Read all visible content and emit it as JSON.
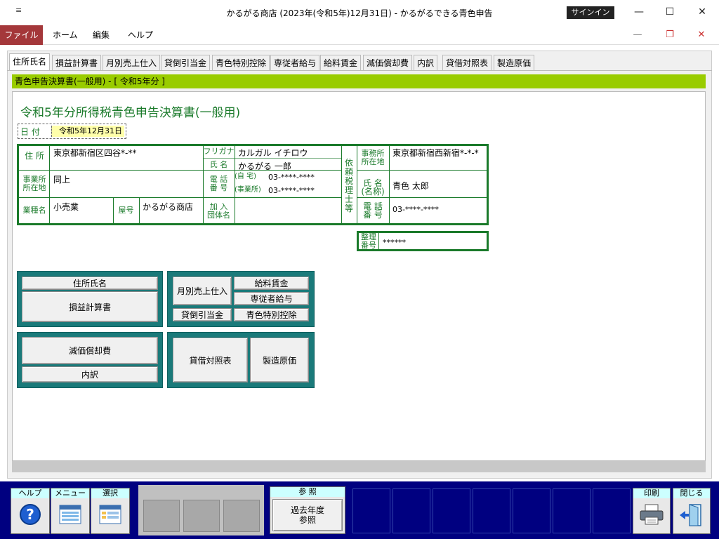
{
  "window": {
    "qat_icon": "quick-access-dropdown",
    "title": "かるがる商店 (2023年(令和5年)12月31日)  -  かるがるできる青色申告",
    "signin": "サインイン",
    "minimize": "—",
    "maximize": "☐",
    "close": "✕"
  },
  "ribbon": {
    "tabs": [
      "ファイル",
      "ホーム",
      "編集",
      "ヘルプ"
    ],
    "doc_minimize": "—",
    "doc_restore": "❐",
    "doc_close": "✕"
  },
  "form_tabs": [
    "住所氏名",
    "損益計算書",
    "月別売上仕入",
    "貸倒引当金",
    "青色特別控除",
    "専従者給与",
    "給料賃金",
    "減価償却費",
    "内訳",
    "貸借対照表",
    "製造原価"
  ],
  "header_bar": "青色申告決算書(一般用) - [ 令和5年分 ]",
  "form": {
    "title": "令和5年分所得税青色申告決算書(一般用)",
    "date_label": "日 付",
    "date_value": "令和5年12月31日"
  },
  "grid": {
    "address_label": "住 所",
    "address_value": "東京都新宿区四谷*-**",
    "furigana_label": "フリガナ",
    "furigana_value": "カルガル イチロウ",
    "name_label": "氏 名",
    "name_value": "かるがる 一郎",
    "office_label_1": "事業所",
    "office_label_2": "所在地",
    "office_value": "同上",
    "phone_label_1": "電 話",
    "phone_label_2": "番 号",
    "home_label": "(自  宅)",
    "home_value": "03-****-****",
    "biz_label": "(事業所)",
    "biz_value": "03-****-****",
    "industry_label": "業種名",
    "industry_value": "小売業",
    "shop_label": "屋号",
    "shop_value": "かるがる商店",
    "assoc_label_1": "加 入",
    "assoc_label_2": "団体名",
    "assoc_value": "",
    "tax_label": "依頼税理士等",
    "tax_office_label_1": "事務所",
    "tax_office_label_2": "所在地",
    "tax_office_value": "東京都新宿西新宿*-*-*",
    "tax_name_label_1": "氏 名",
    "tax_name_label_2": "(名称)",
    "tax_name_value": "青色 太郎",
    "tax_phone_label_1": "電 話",
    "tax_phone_label_2": "番 号",
    "tax_phone_value": "03-****-****",
    "seiri_label_1": "整理",
    "seiri_label_2": "番号",
    "seiri_value": "******"
  },
  "buttons": {
    "jusho_shimei": "住所氏名",
    "soneki": "損益計算書",
    "monthly": "月別売上仕入",
    "kyuryo": "給料賃金",
    "senju": "専従者給与",
    "kashidaore": "貸倒引当金",
    "aoiro": "青色特別控除",
    "genka": "減価償却費",
    "uchiwake": "内訳",
    "taishaku": "貸借対照表",
    "seizo": "製造原価"
  },
  "toolbar": {
    "help_label": "ヘルプ",
    "menu_label": "メニュー",
    "select_label": "選択",
    "ref_label": "参 照",
    "ref_button": "過去年度参照",
    "print_label": "印刷",
    "close_label": "閉じる"
  },
  "colors": {
    "green": "#1a7a2a",
    "teal": "#1a7a7a",
    "navy": "#000080",
    "header_bar": "#99cc00",
    "file_tab": "#a4373a"
  }
}
